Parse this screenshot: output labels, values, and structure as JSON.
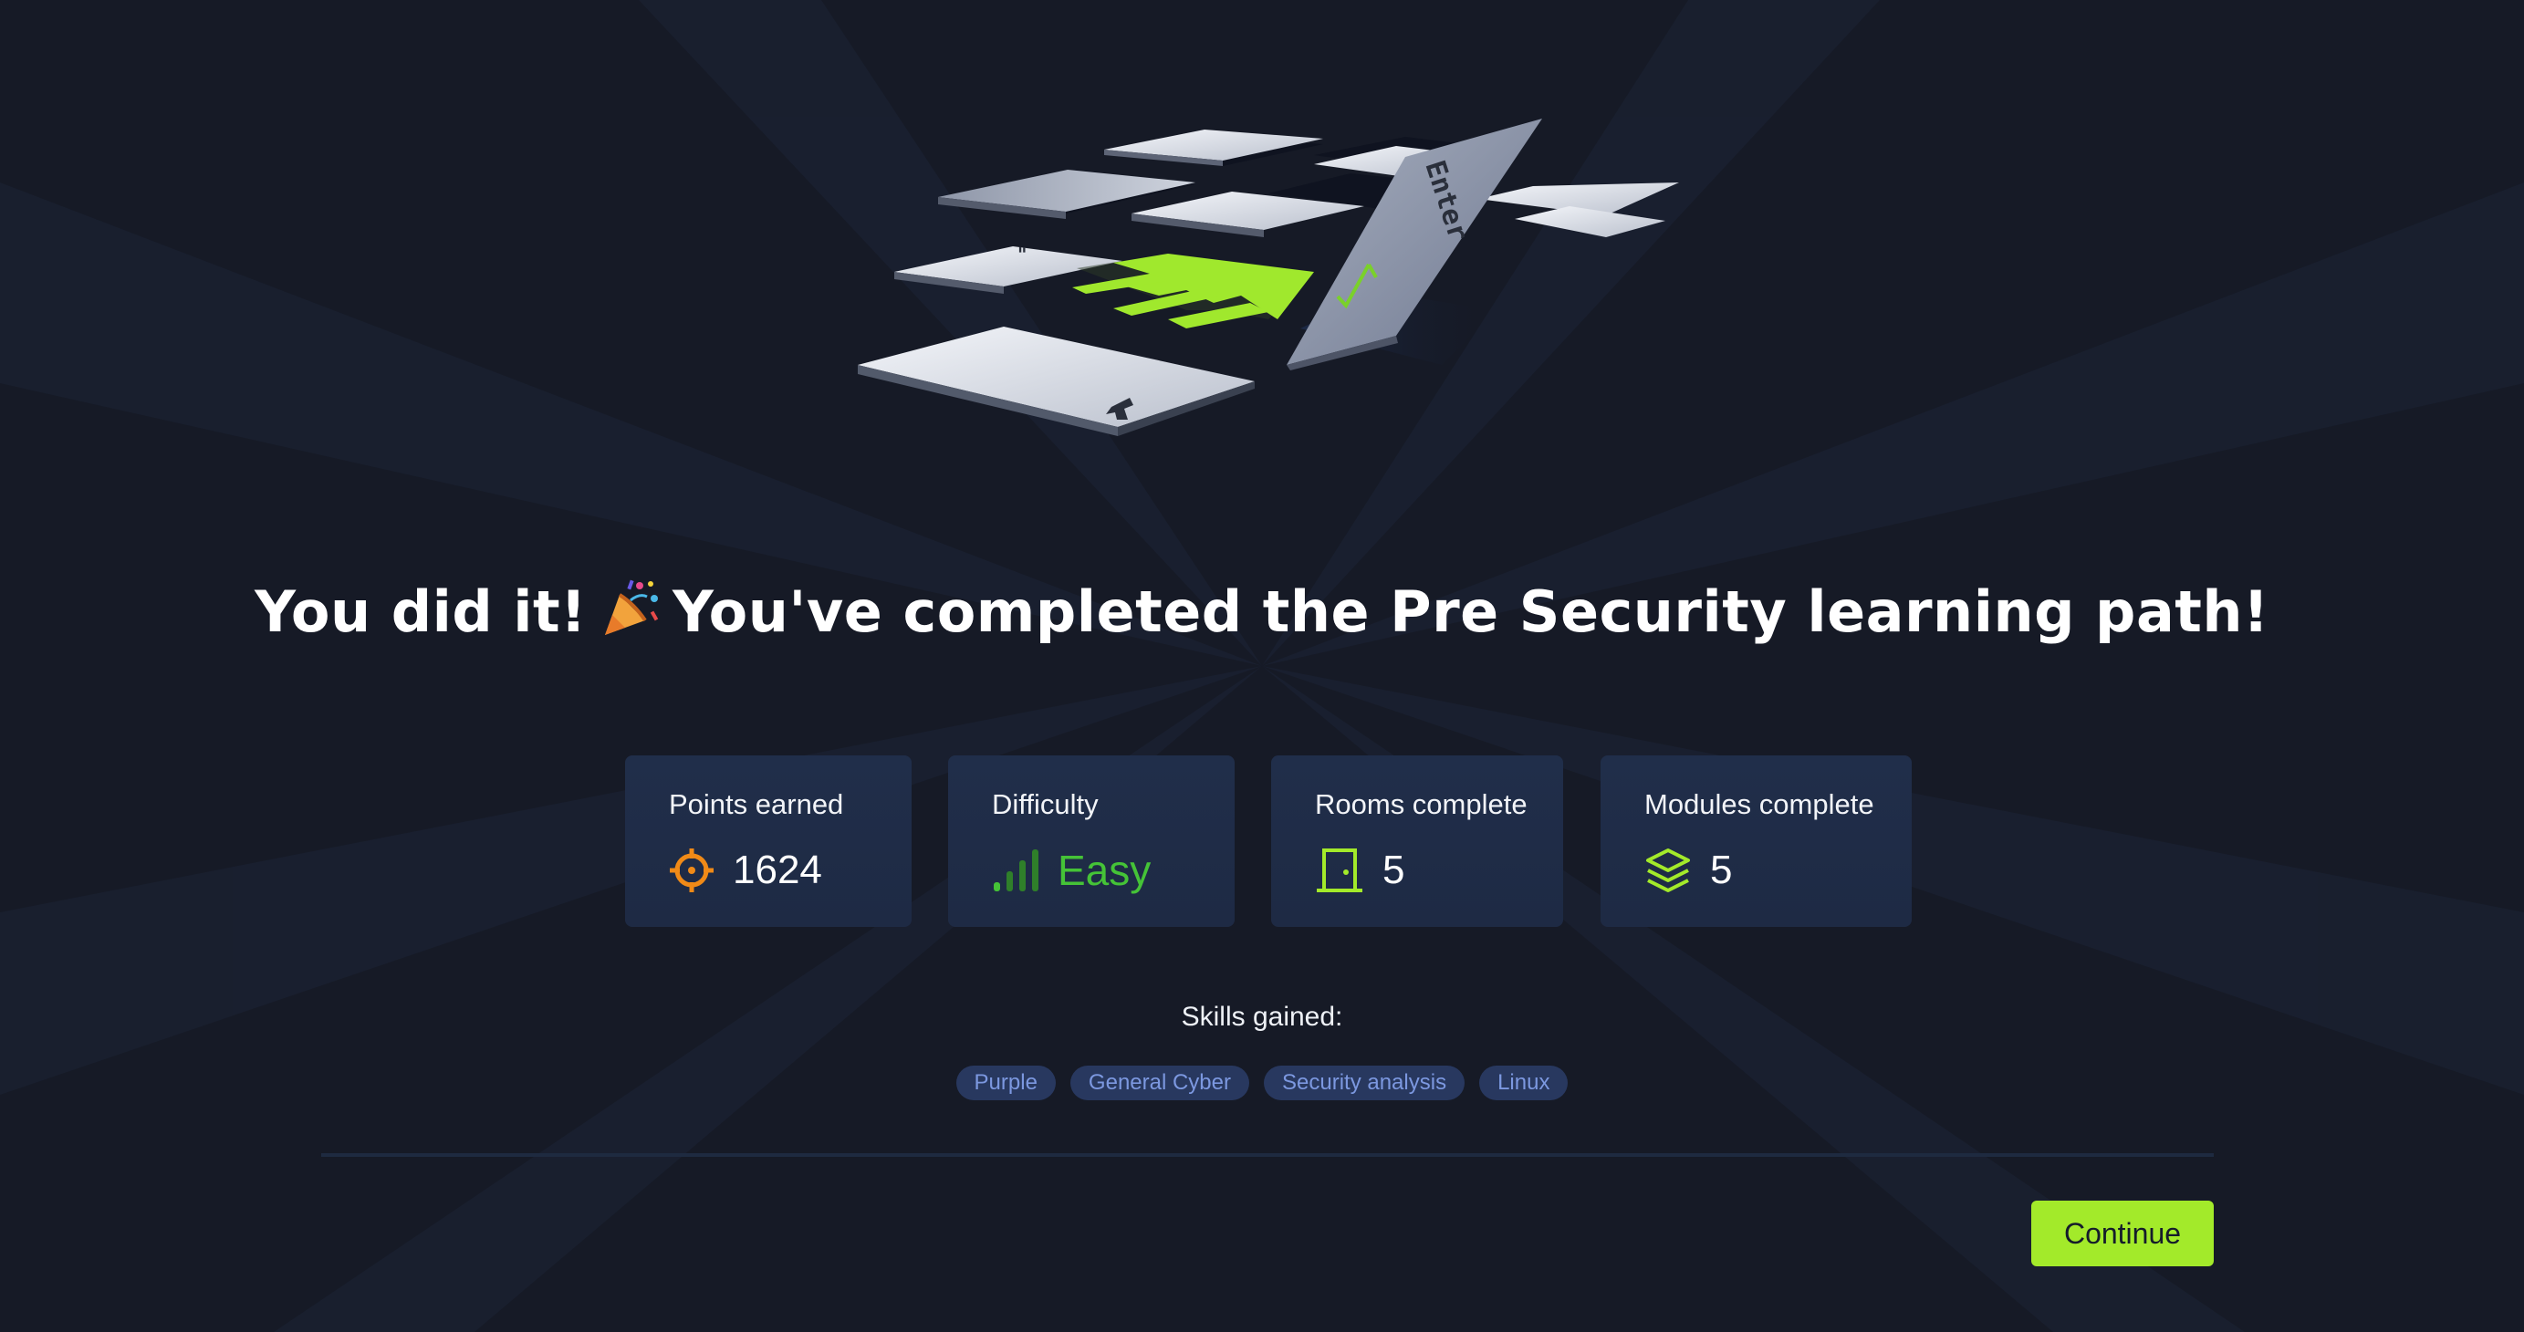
{
  "hero": {
    "key_label": "Enter"
  },
  "title": {
    "before": "You did it!",
    "emoji": "party-popper",
    "after": "You've completed the Pre Security learning path!"
  },
  "stats": [
    {
      "label": "Points earned",
      "value": "1624",
      "icon": "target-icon",
      "color": "#f08a17"
    },
    {
      "label": "Difficulty",
      "value": "Easy",
      "icon": "difficulty-bars-icon",
      "color": "#45c337"
    },
    {
      "label": "Rooms complete",
      "value": "5",
      "icon": "door-icon",
      "color": "#a3ea2a"
    },
    {
      "label": "Modules complete",
      "value": "5",
      "icon": "layers-icon",
      "color": "#a3ea2a"
    }
  ],
  "skills": {
    "title": "Skills gained:",
    "tags": [
      "Purple",
      "General Cyber",
      "Security analysis",
      "Linux"
    ]
  },
  "actions": {
    "continue_label": "Continue",
    "accent": "#a3ea2a"
  },
  "colors": {
    "background": "#161a26",
    "card": "#1e2a44",
    "tag_bg": "#28385f",
    "tag_text": "#7c98e0"
  }
}
